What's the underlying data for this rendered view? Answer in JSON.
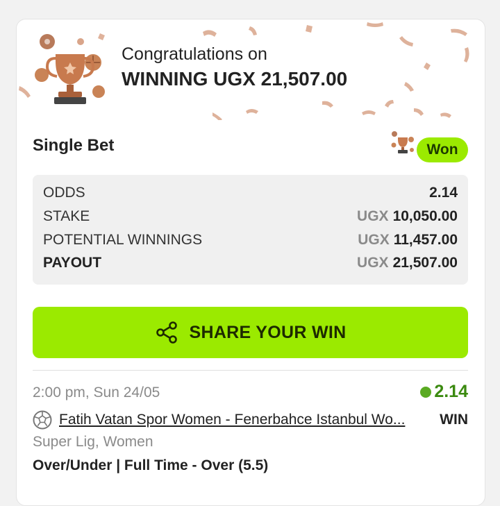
{
  "banner": {
    "congrats_text": "Congratulations on",
    "winning_text": "WINNING UGX 21,507.00"
  },
  "bet": {
    "title": "Single Bet",
    "status_badge": "Won",
    "rows": [
      {
        "label": "ODDS",
        "currency": "",
        "value": "2.14",
        "bold_label": false
      },
      {
        "label": "STAKE",
        "currency": "UGX",
        "value": "10,050.00",
        "bold_label": false
      },
      {
        "label": "POTENTIAL WINNINGS",
        "currency": "UGX",
        "value": "11,457.00",
        "bold_label": false
      },
      {
        "label": "PAYOUT",
        "currency": "UGX",
        "value": "21,507.00",
        "bold_label": true
      }
    ]
  },
  "share_button": {
    "label": "SHARE YOUR WIN",
    "icon": "share-icon"
  },
  "selection": {
    "time": "2:00 pm, Sun 24/05",
    "odds": "2.14",
    "match": "Fatih Vatan Spor Women - Fenerbahce Istanbul Wo...",
    "result": "WIN",
    "league": "Super Lig, Women",
    "market": "Over/Under | Full Time - Over (5.5)",
    "sport_icon": "soccer-ball-icon"
  },
  "colors": {
    "accent": "#9bea00",
    "odds_green": "#3b8a10",
    "confetti": "#d9a58a",
    "trophy": "#c87a4e"
  }
}
